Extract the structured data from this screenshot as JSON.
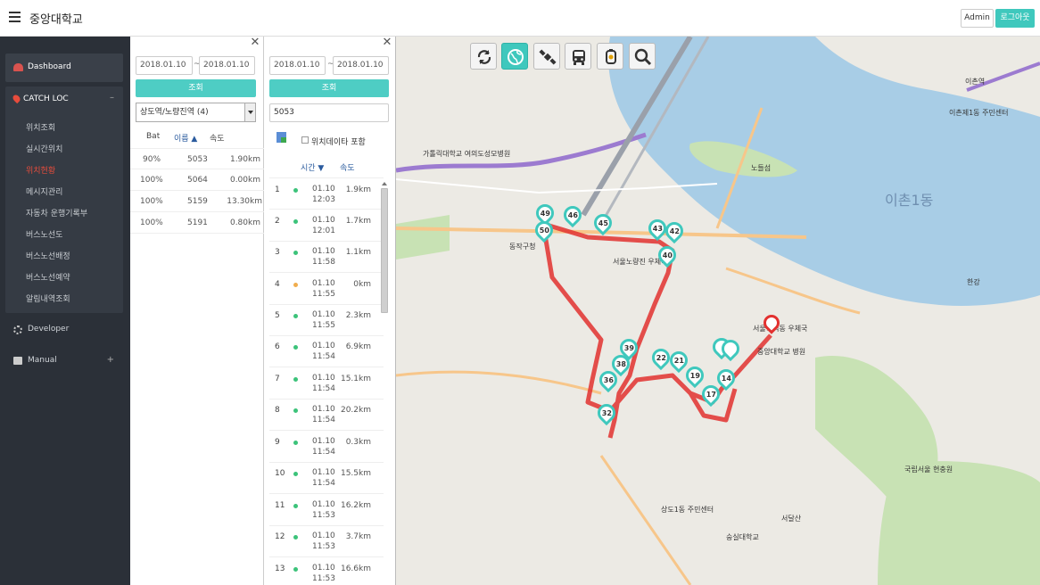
{
  "header": {
    "brand": "중앙대학교",
    "admin_label": "Admin",
    "logout_label": "로그아웃"
  },
  "sidebar": {
    "dashboard": "Dashboard",
    "catch_loc": "CATCH LOC",
    "collapse": "–",
    "items": [
      "위치조회",
      "실시간위치",
      "위치현황",
      "메시지관리",
      "자동차 운행기록부",
      "버스노선도",
      "버스노선배정",
      "버스노선예약",
      "알림내역조회"
    ],
    "developer": "Developer",
    "manual": "Manual",
    "expand": "+"
  },
  "panel1": {
    "close": "✕",
    "date_from": "2018.01.10",
    "date_to": "2018.01.10",
    "tilde": "~",
    "query_label": "조회",
    "select_value": "상도역/노량진역 (4)",
    "headers": {
      "bat": "Bat",
      "name": "이름 ▲",
      "speed": "속도"
    },
    "rows": [
      {
        "bat": "90%",
        "name": "5053",
        "speed": "1.90km"
      },
      {
        "bat": "100%",
        "name": "5064",
        "speed": "0.00km"
      },
      {
        "bat": "100%",
        "name": "5159",
        "speed": "13.30km"
      },
      {
        "bat": "100%",
        "name": "5191",
        "speed": "0.80km"
      }
    ]
  },
  "panel2": {
    "close": "✕",
    "date_from": "2018.01.10",
    "date_to": "2018.01.10",
    "tilde": "~",
    "query_label": "조회",
    "device_value": "5053",
    "include_label": "위치데이타 포함",
    "headers": {
      "time": "시간 ▼",
      "speed": "속도"
    },
    "rows": [
      {
        "no": "1",
        "date": "01.10",
        "time": "12:03",
        "km": "1.9km",
        "status": "green"
      },
      {
        "no": "2",
        "date": "01.10",
        "time": "12:01",
        "km": "1.7km",
        "status": "green"
      },
      {
        "no": "3",
        "date": "01.10",
        "time": "11:58",
        "km": "1.1km",
        "status": "green"
      },
      {
        "no": "4",
        "date": "01.10",
        "time": "11:55",
        "km": "0km",
        "status": "orange"
      },
      {
        "no": "5",
        "date": "01.10",
        "time": "11:55",
        "km": "2.3km",
        "status": "green"
      },
      {
        "no": "6",
        "date": "01.10",
        "time": "11:54",
        "km": "6.9km",
        "status": "green"
      },
      {
        "no": "7",
        "date": "01.10",
        "time": "11:54",
        "km": "15.1km",
        "status": "green"
      },
      {
        "no": "8",
        "date": "01.10",
        "time": "11:54",
        "km": "20.2km",
        "status": "green"
      },
      {
        "no": "9",
        "date": "01.10",
        "time": "11:54",
        "km": "0.3km",
        "status": "green"
      },
      {
        "no": "10",
        "date": "01.10",
        "time": "11:54",
        "km": "15.5km",
        "status": "green"
      },
      {
        "no": "11",
        "date": "01.10",
        "time": "11:53",
        "km": "16.2km",
        "status": "green"
      },
      {
        "no": "12",
        "date": "01.10",
        "time": "11:53",
        "km": "3.7km",
        "status": "green"
      },
      {
        "no": "13",
        "date": "01.10",
        "time": "11:53",
        "km": "16.6km",
        "status": "green"
      }
    ]
  },
  "map": {
    "colors": {
      "water": "#a8cde6",
      "land": "#eceae4",
      "park": "#c8e2b4",
      "route": "#e2312f",
      "marker": "#3fc8bd"
    },
    "toolbar_icons": [
      "refresh-icon",
      "globe-icon",
      "satellite-icon",
      "bus-icon",
      "beacon-icon",
      "search-icon"
    ],
    "labels": {
      "dongjak": "동작구청",
      "noryangjin_post": "서울노량진 우체국",
      "heukseok_post": "서울흑석동 우체국",
      "cau_hospital": "중앙대학교 병원",
      "soongsil": "숭실대학교",
      "sangdo1": "상도1동 주민센터",
      "ichon_station": "이촌역",
      "ichon1": "이촌제1동 주민센터",
      "hangang": "한강",
      "nodeul": "노들섬",
      "ichon_dong": "이촌1동",
      "yeouido_hospital": "가톨릭대학교 여의도성모병원",
      "kukrip": "국립서울 현충원",
      "seodal": "서달산"
    },
    "markers": [
      "49",
      "46",
      "45",
      "43",
      "42",
      "50",
      "40",
      "39",
      "38",
      "22",
      "21",
      "19",
      "17",
      "36",
      "32",
      "14"
    ]
  }
}
